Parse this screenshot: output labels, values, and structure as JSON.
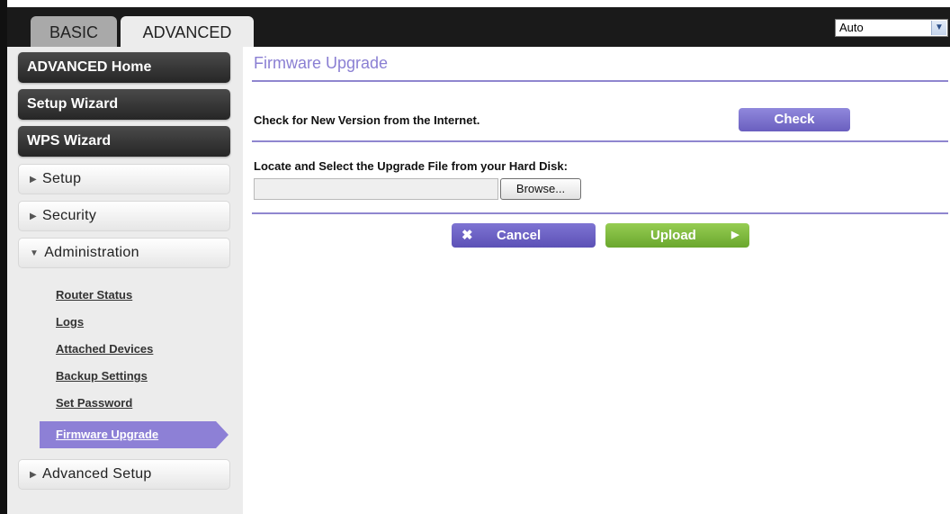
{
  "tabs": {
    "basic": "BASIC",
    "advanced": "ADVANCED"
  },
  "language_select": {
    "value": "Auto"
  },
  "sidebar": {
    "advanced_home": "ADVANCED Home",
    "setup_wizard": "Setup Wizard",
    "wps_wizard": "WPS Wizard",
    "setup": "Setup",
    "security": "Security",
    "administration": "Administration",
    "admin_items": [
      "Router Status",
      "Logs",
      "Attached Devices",
      "Backup Settings",
      "Set Password"
    ],
    "active_item": "Firmware Upgrade",
    "advanced_setup": "Advanced Setup"
  },
  "main": {
    "title": "Firmware Upgrade",
    "check_label": "Check for New Version from the Internet.",
    "check_button": "Check",
    "locate_label": "Locate and Select the Upgrade File from your Hard Disk:",
    "file_value": "",
    "browse_button": "Browse...",
    "cancel_button": "Cancel",
    "upload_button": "Upload"
  },
  "colors": {
    "accent_purple": "#8a7fd3",
    "upload_green": "#7dbb3f",
    "menu_dark": "#333333"
  }
}
